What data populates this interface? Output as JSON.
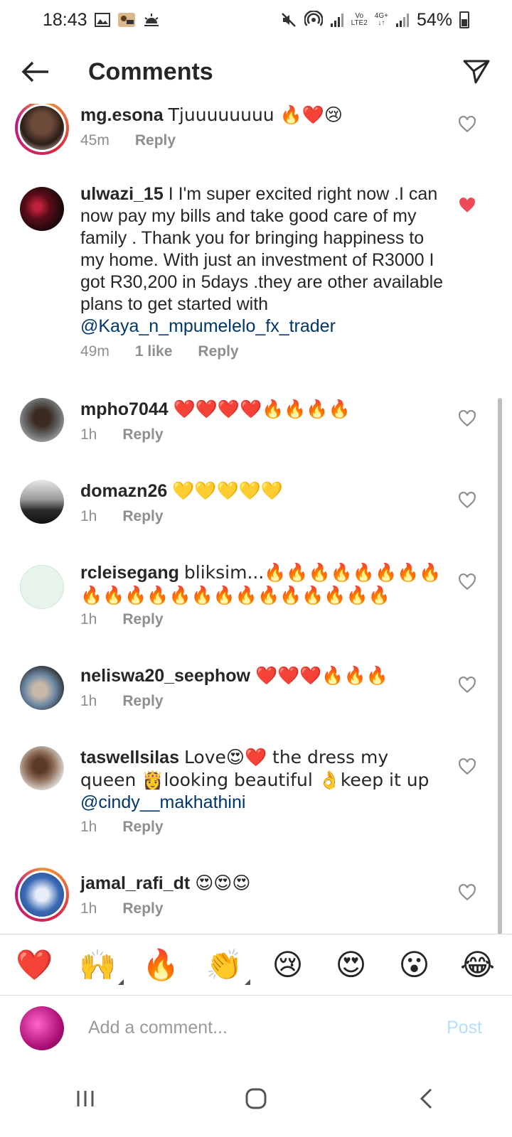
{
  "status_bar": {
    "time": "18:43",
    "battery": "54%",
    "network_top": "Vo",
    "network_bottom": "LTE2",
    "network_gen": "4G+"
  },
  "header": {
    "title": "Comments"
  },
  "comments": [
    {
      "username": "mg.esona",
      "text": "Tjuuuuuuuu 🔥❤️😢",
      "time": "45m",
      "likes": "",
      "reply": "Reply",
      "liked": false
    },
    {
      "username": "ulwazi_15",
      "text": "I I'm super excited right now .I can now pay my bills and take good care of my family . Thank you for bringing happiness to my home. With just an investment of R3000 I got R30,200 in 5days .they are other available plans to get started with ",
      "mention": "@Kaya_n_mpumelelo_fx_trader",
      "time": "49m",
      "likes": "1 like",
      "reply": "Reply",
      "liked": true
    },
    {
      "username": "mpho7044",
      "text": "❤️❤️❤️❤️🔥🔥🔥🔥",
      "time": "1h",
      "likes": "",
      "reply": "Reply",
      "liked": false
    },
    {
      "username": "domazn26",
      "text": "💛💛💛💛💛",
      "time": "1h",
      "likes": "",
      "reply": "Reply",
      "liked": false
    },
    {
      "username": "rcleisegang",
      "text": "bliksim...🔥🔥🔥🔥🔥🔥🔥🔥🔥🔥🔥🔥🔥🔥🔥🔥🔥🔥🔥🔥🔥🔥",
      "time": "1h",
      "likes": "",
      "reply": "Reply",
      "liked": false
    },
    {
      "username": "neliswa20_seephow",
      "text": "❤️❤️❤️🔥🔥🔥",
      "time": "1h",
      "likes": "",
      "reply": "Reply",
      "liked": false
    },
    {
      "username": "taswellsilas",
      "text": "Love😍❤️ the dress my queen 👸looking beautiful 👌keep it up ",
      "mention": "@cindy__makhathini",
      "time": "1h",
      "likes": "",
      "reply": "Reply",
      "liked": false
    },
    {
      "username": "jamal_rafi_dt",
      "text": "😍😍😍",
      "time": "1h",
      "likes": "",
      "reply": "Reply",
      "liked": false
    }
  ],
  "reactions": [
    "❤️",
    "🙌",
    "🔥",
    "👏",
    "😢",
    "😍",
    "😮",
    "😂"
  ],
  "composer": {
    "placeholder": "Add a comment...",
    "post_label": "Post"
  },
  "colors": {
    "like_red": "#ed4956",
    "mention_blue": "#00376b",
    "post_disabled": "#b2dffc",
    "meta_gray": "#8e8e8e"
  }
}
